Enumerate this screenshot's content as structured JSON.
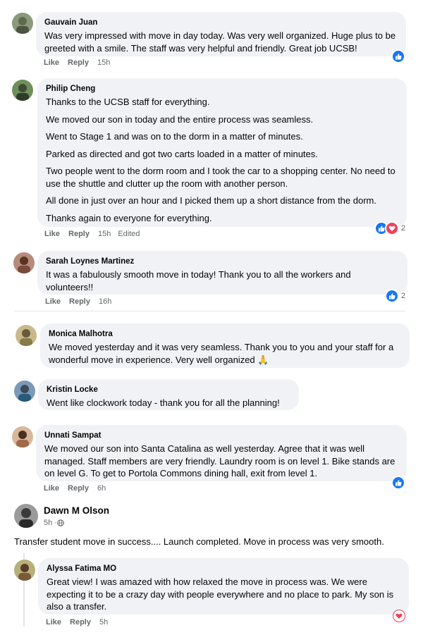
{
  "comments": [
    {
      "author": "Gauvain Juan",
      "text": "Was very impressed with move in day today. Was very well organized. Huge plus to be greeted with a smile. The staff was very helpful and friendly. Great job UCSB!",
      "like": "Like",
      "reply": "Reply",
      "time": "15h",
      "reaction_count": ""
    },
    {
      "author": "Philip Cheng",
      "paragraphs": [
        "Thanks to the UCSB staff for everything.",
        "We moved our son in today and the entire process was seamless.",
        "Went to Stage 1 and was on to the dorm in a matter of minutes.",
        "Parked as directed and got two carts loaded in a matter of minutes.",
        "Two people went to the dorm room and I took the car to a shopping center. No need to use the shuttle and clutter up the room with another person.",
        "All done in just over an hour and I picked them up a short distance from the dorm.",
        "Thanks again to everyone for everything."
      ],
      "like": "Like",
      "reply": "Reply",
      "time": "15h",
      "edited": "Edited",
      "reaction_count": "2"
    },
    {
      "author": "Sarah Loynes Martinez",
      "text": "It was a fabulously smooth move in today! Thank you to all the workers and volunteers!!",
      "like": "Like",
      "reply": "Reply",
      "time": "16h",
      "reaction_count": "2"
    },
    {
      "author": "Monica Malhotra",
      "text": "We moved yesterday and it was very seamless. Thank you to you and your staff for a wonderful move in experience. Very well organized",
      "emoji": "🙏"
    },
    {
      "author": "Kristin Locke",
      "text": "Went like clockwork today - thank you for all the planning!"
    },
    {
      "author": "Unnati Sampat",
      "text": "We moved our son into Santa Catalina as well yesterday. Agree that it was well managed. Staff members are very friendly. Laundry room is on level 1. Bike stands are on level G. To get to Portola Commons dining hall, exit from level 1.",
      "like": "Like",
      "reply": "Reply",
      "time": "6h"
    }
  ],
  "post": {
    "author": "Dawn M Olson",
    "time": "5h · ",
    "audience_icon": "globe-icon",
    "text": "Transfer student move in success.... Launch completed. Move in process was very smooth."
  },
  "reply_comment": {
    "author": "Alyssa Fatima MO",
    "text": "Great view! I was amazed with how relaxed the move in process was. We were expecting it to be a crazy day with people everywhere and no place to park. My son is also a transfer.",
    "like": "Like",
    "reply": "Reply",
    "time": "5h"
  },
  "colors": {
    "bubble": "#f0f2f5",
    "like_blue": "#1877f2",
    "love_red": "#f33e58",
    "meta_gray": "#65676b"
  }
}
